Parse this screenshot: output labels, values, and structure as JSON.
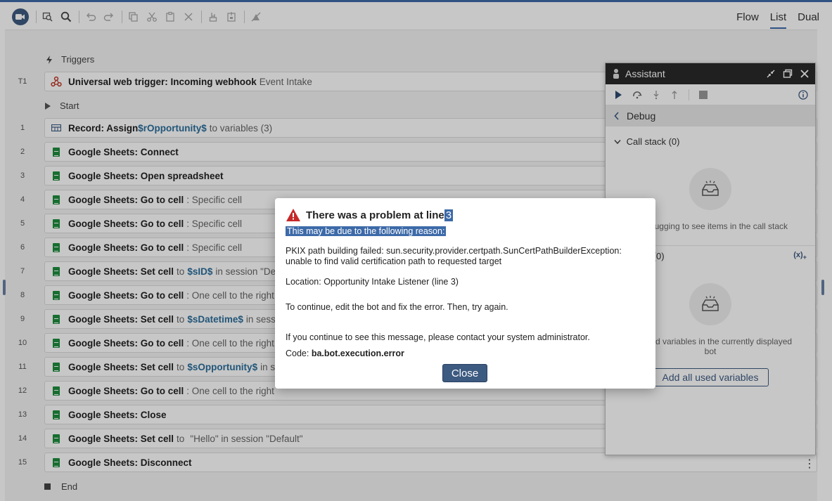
{
  "views": [
    "Flow",
    "List",
    "Dual"
  ],
  "toolbar_icons": [
    "record-icon",
    "zoom-fit-icon",
    "search-icon",
    "undo-icon",
    "redo-icon",
    "copy-icon",
    "cut-icon",
    "paste-icon",
    "delete-icon",
    "enable-icon",
    "disable-icon",
    "no-breakpoint-icon"
  ],
  "triggers": {
    "label": "Triggers",
    "t1": {
      "num": "T1",
      "name": "Universal web trigger: Incoming webhook",
      "detail": "Event Intake"
    }
  },
  "start_label": "Start",
  "end_label": "End",
  "rows": [
    {
      "num": "1",
      "bold": "Record: Assign",
      "var": "$rOpportunity$",
      "rest": "to variables (3)"
    },
    {
      "num": "2",
      "bold": "Google Sheets: Connect"
    },
    {
      "num": "3",
      "bold": "Google Sheets: Open spreadsheet"
    },
    {
      "num": "4",
      "bold": "Google Sheets: Go to cell",
      "rest": ": Specific cell"
    },
    {
      "num": "5",
      "bold": "Google Sheets: Go to cell",
      "rest": ": Specific cell"
    },
    {
      "num": "6",
      "bold": "Google Sheets: Go to cell",
      "rest": ": Specific cell"
    },
    {
      "num": "7",
      "bold": "Google Sheets: Set cell",
      "mid": "to",
      "var": "$sID$",
      "rest": "in session \"Defau"
    },
    {
      "num": "8",
      "bold": "Google Sheets: Go to cell",
      "rest": ": One cell to the right"
    },
    {
      "num": "9",
      "bold": "Google Sheets: Set cell",
      "mid": "to",
      "var": "$sDatetime$",
      "rest": "in session"
    },
    {
      "num": "10",
      "bold": "Google Sheets: Go to cell",
      "rest": ": One cell to the right"
    },
    {
      "num": "11",
      "bold": "Google Sheets: Set cell",
      "mid": "to",
      "var": "$sOpportunity$",
      "rest": "in sess"
    },
    {
      "num": "12",
      "bold": "Google Sheets: Go to cell",
      "rest": ": One cell to the right"
    },
    {
      "num": "13",
      "bold": "Google Sheets: Close"
    },
    {
      "num": "14",
      "bold": "Google Sheets: Set cell",
      "mid": "to",
      "rest": "\"Hello\" in session \"Default\""
    },
    {
      "num": "15",
      "bold": "Google Sheets: Disconnect"
    }
  ],
  "assistant": {
    "title": "Assistant",
    "section": "Debug",
    "call_stack": "Call stack (0)",
    "call_stack_empty": "rt debugging to see items in the call stack",
    "variables": "variables (0)",
    "variables_empty": "watched variables in the currently displayed bot",
    "add_button": "Add all used variables"
  },
  "dialog": {
    "title": "There was a problem at line",
    "line": "3",
    "reason_label": "This may be due to the following reason:",
    "message": "PKIX path building failed: sun.security.provider.certpath.SunCertPathBuilderException: unable to find valid certification path to requested target",
    "location": "Location: Opportunity Intake Listener (line 3)",
    "instruction": "To continue, edit the bot and fix the error. Then, try again.",
    "contact": "If you continue to see this message, please contact your system administrator.",
    "code_label": "Code:",
    "code_value": "ba.bot.execution.error",
    "close_label": "Close"
  }
}
